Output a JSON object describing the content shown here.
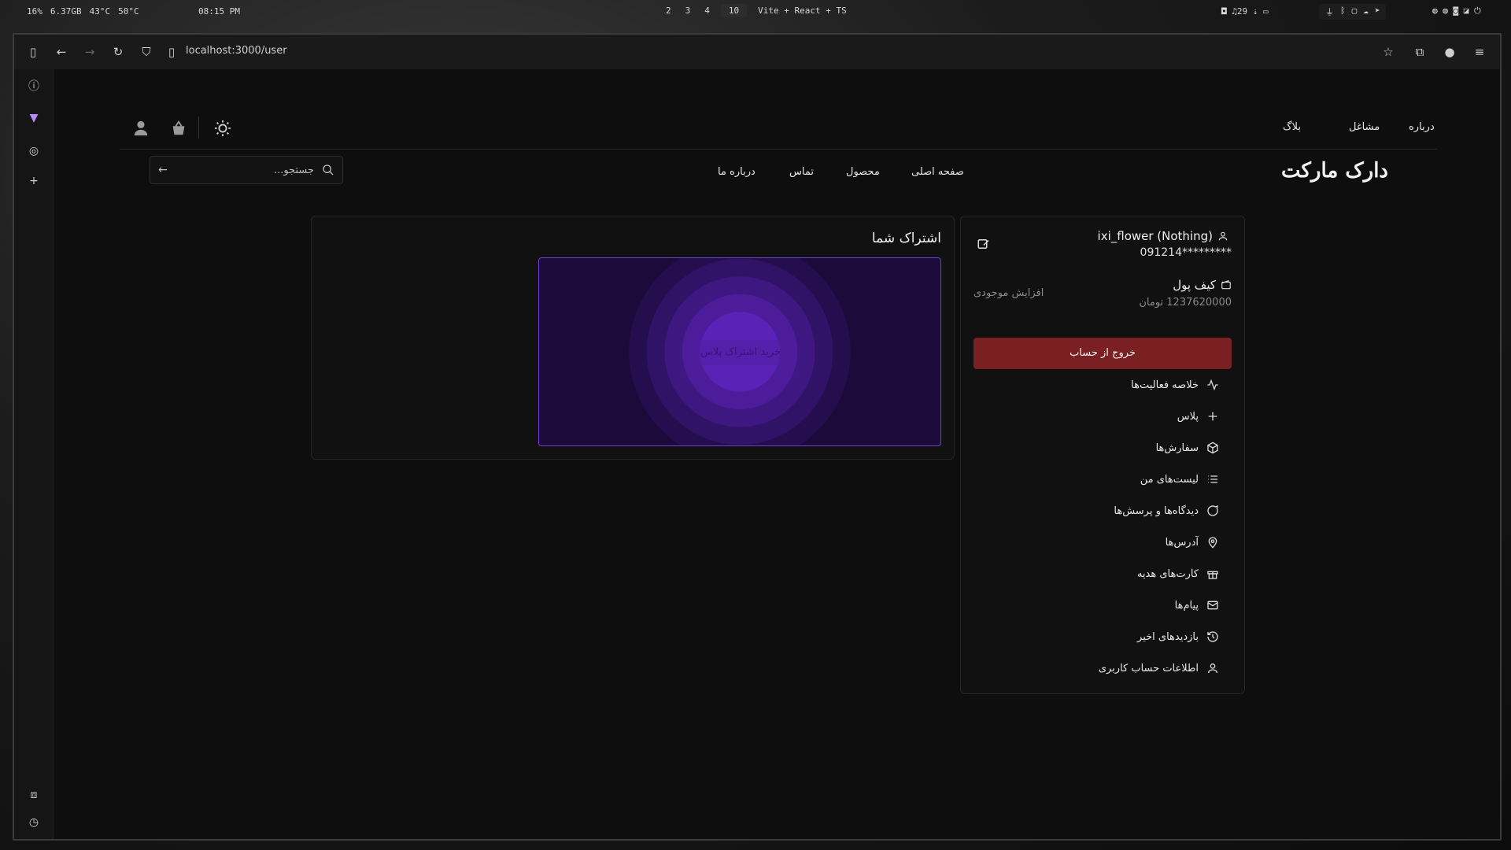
{
  "os_bar": {
    "stats": [
      "16%",
      "6.37GB",
      "43°C",
      "50°C"
    ],
    "clock": "08:15 PM",
    "workspaces": [
      "2",
      "3",
      "4",
      "10"
    ],
    "active_workspace": "10",
    "window_title": "Vite + React + TS",
    "volume": "29"
  },
  "browser": {
    "url": "localhost:3000/user"
  },
  "header": {
    "top_links": [
      "درباره",
      "مشاغل",
      "بلاگ"
    ],
    "brand": "دارک مارکت",
    "nav": [
      "صفحه اصلی",
      "محصول",
      "تماس",
      "درباره ما"
    ],
    "search_placeholder": "جستجو..."
  },
  "profile": {
    "username": "ixi_flower (Nothing)",
    "phone": "091214*********",
    "wallet_title": "کیف پول",
    "wallet_amount": "1237620000 تومان",
    "add_balance": "افزایش موجودی",
    "logout": "خروج از حساب",
    "menu": [
      {
        "label": "خلاصه فعالیت‌ها",
        "icon": "activity-icon"
      },
      {
        "label": "پلاس",
        "icon": "plus-icon"
      },
      {
        "label": "سفارش‌ها",
        "icon": "package-icon"
      },
      {
        "label": "لیست‌های من",
        "icon": "list-icon"
      },
      {
        "label": "دیدگاه‌ها و پرسش‌ها",
        "icon": "message-circle-icon"
      },
      {
        "label": "آدرس‌ها",
        "icon": "map-pin-icon"
      },
      {
        "label": "کارت‌های هدیه",
        "icon": "gift-icon"
      },
      {
        "label": "پیام‌ها",
        "icon": "mail-icon"
      },
      {
        "label": "بازدیدهای اخیر",
        "icon": "history-icon"
      },
      {
        "label": "اطلاعات حساب کاربری",
        "icon": "user-icon"
      }
    ]
  },
  "subscription": {
    "title": "اشتراک شما",
    "buy_plus": "خرید اشتراک پلاس"
  },
  "colors": {
    "accent_purple": "#5b22b8",
    "logout_red": "#7a1f22",
    "background": "#0e0e0e"
  }
}
